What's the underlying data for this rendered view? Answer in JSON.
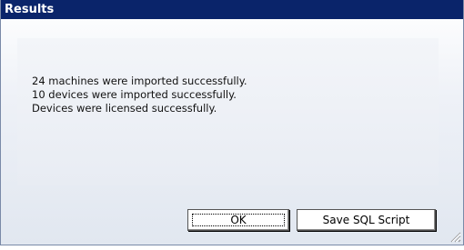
{
  "window": {
    "title": "Results"
  },
  "messages": [
    "24 machines were imported successfully.",
    "10 devices were imported successfully.",
    "Devices were licensed successfully."
  ],
  "buttons": {
    "ok_label": "OK",
    "save_sql_label": "Save SQL Script"
  },
  "icons": {
    "resize_grip": "resize-grip-icon"
  },
  "colors": {
    "title_bar": "#0a246a",
    "title_text": "#ffffff"
  }
}
